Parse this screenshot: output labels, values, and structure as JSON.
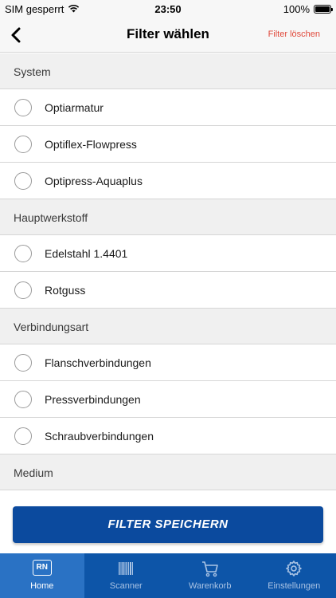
{
  "status_bar": {
    "carrier": "SIM gesperrt",
    "time": "23:50",
    "battery": "100%"
  },
  "nav": {
    "title": "Filter wählen",
    "clear_label": "Filter löschen"
  },
  "sections": [
    {
      "title": "System",
      "items": [
        "Optiarmatur",
        "Optiflex-Flowpress",
        "Optipress-Aquaplus"
      ]
    },
    {
      "title": "Hauptwerkstoff",
      "items": [
        "Edelstahl 1.4401",
        "Rotguss"
      ]
    },
    {
      "title": "Verbindungsart",
      "items": [
        "Flanschverbindungen",
        "Pressverbindungen",
        "Schraubverbindungen"
      ]
    },
    {
      "title": "Medium",
      "items": []
    }
  ],
  "save_button": {
    "label": "FILTER SPEICHERN"
  },
  "tabs": [
    {
      "label": "Home",
      "icon": "rn-logo-icon",
      "active": true,
      "logo_text": "RN"
    },
    {
      "label": "Scanner",
      "icon": "barcode-icon",
      "active": false
    },
    {
      "label": "Warenkorb",
      "icon": "cart-icon",
      "active": false
    },
    {
      "label": "Einstellungen",
      "icon": "gear-icon",
      "active": false
    }
  ],
  "colors": {
    "accent_blue": "#0b4a9e",
    "tab_bar": "#0d55a8",
    "clear_red": "#e0483a"
  }
}
